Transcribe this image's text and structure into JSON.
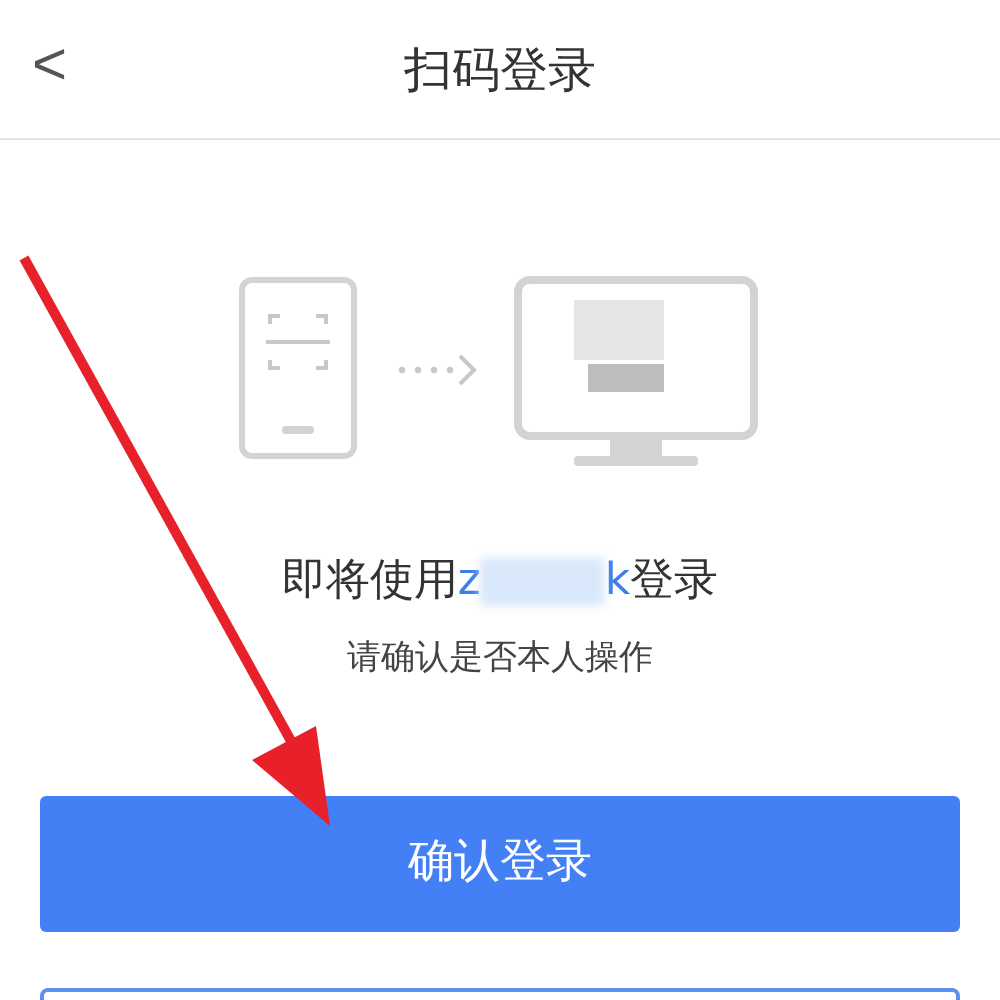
{
  "header": {
    "back": "<",
    "title": "扫码登录"
  },
  "prompt": {
    "before": "即将使用",
    "account_start": "z",
    "account_end": "k",
    "after": "登录"
  },
  "subtitle": "请确认是否本人操作",
  "confirm_button": "确认登录"
}
